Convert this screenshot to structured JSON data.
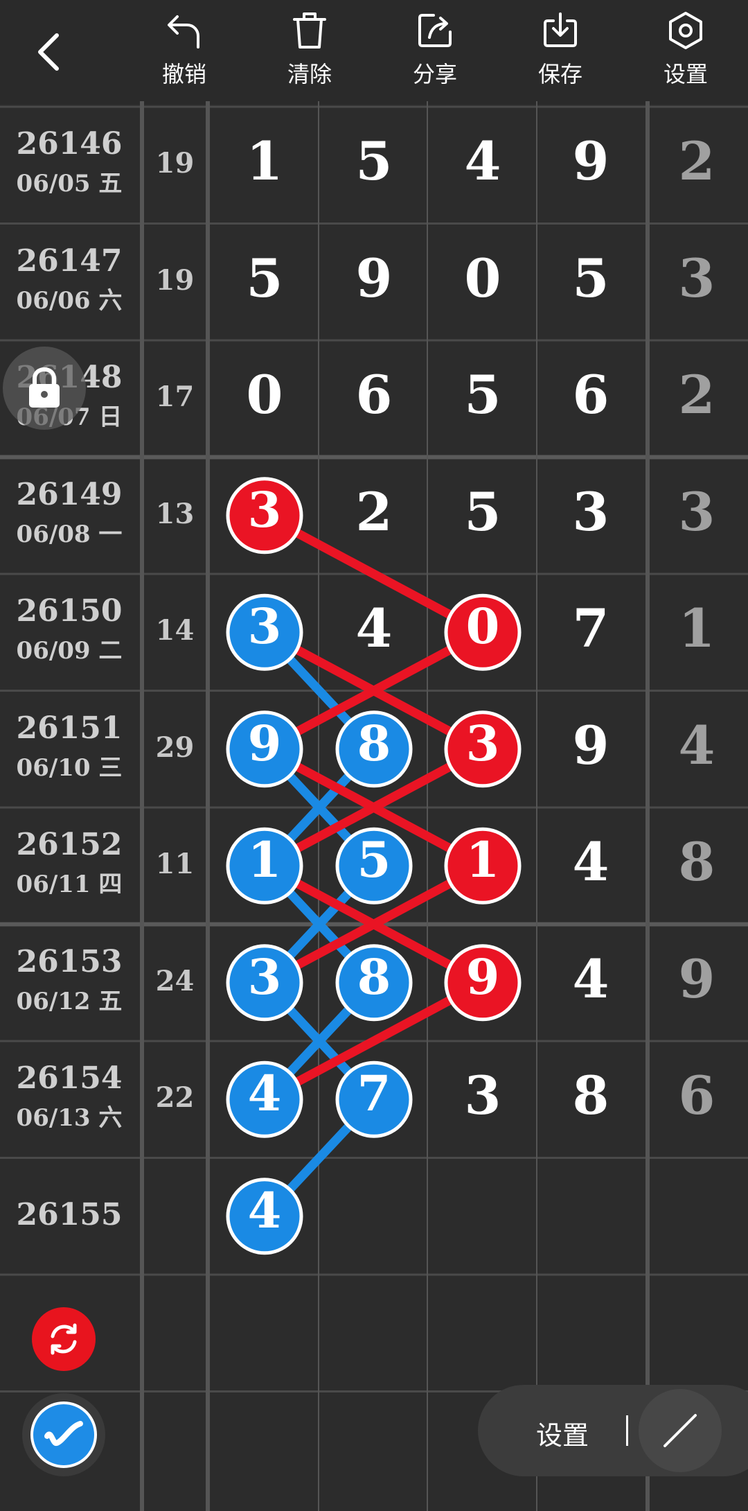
{
  "toolbar": {
    "back_icon": "chevron-left-icon",
    "items": [
      {
        "label": "撤销",
        "icon": "undo-icon"
      },
      {
        "label": "清除",
        "icon": "trash-icon"
      },
      {
        "label": "分享",
        "icon": "share-icon"
      },
      {
        "label": "保存",
        "icon": "download-icon"
      },
      {
        "label": "设置",
        "icon": "hexagon-settings-icon"
      }
    ]
  },
  "rows": [
    {
      "period": "26146",
      "date": "06/05 五",
      "sum": "19",
      "digits": [
        "1",
        "5",
        "4",
        "9"
      ],
      "fifth": "2"
    },
    {
      "period": "26147",
      "date": "06/06 六",
      "sum": "19",
      "digits": [
        "5",
        "9",
        "0",
        "5"
      ],
      "fifth": "3"
    },
    {
      "period": "26148",
      "date": "06/07 日",
      "sum": "17",
      "digits": [
        "0",
        "6",
        "5",
        "6"
      ],
      "fifth": "2"
    },
    {
      "period": "26149",
      "date": "06/08 一",
      "sum": "13",
      "digits": [
        "3",
        "2",
        "5",
        "3"
      ],
      "fifth": "3"
    },
    {
      "period": "26150",
      "date": "06/09 二",
      "sum": "14",
      "digits": [
        "3",
        "4",
        "0",
        "7"
      ],
      "fifth": "1"
    },
    {
      "period": "26151",
      "date": "06/10 三",
      "sum": "29",
      "digits": [
        "9",
        "8",
        "3",
        "9"
      ],
      "fifth": "4"
    },
    {
      "period": "26152",
      "date": "06/11 四",
      "sum": "11",
      "digits": [
        "1",
        "5",
        "1",
        "4"
      ],
      "fifth": "8"
    },
    {
      "period": "26153",
      "date": "06/12 五",
      "sum": "24",
      "digits": [
        "3",
        "8",
        "9",
        "4"
      ],
      "fifth": "9"
    },
    {
      "period": "26154",
      "date": "06/13 六",
      "sum": "22",
      "digits": [
        "4",
        "7",
        "3",
        "8"
      ],
      "fifth": "6"
    },
    {
      "period": "26155",
      "date": "",
      "sum": "",
      "digits": [
        "4",
        "",
        "",
        ""
      ],
      "fifth": ""
    }
  ],
  "markers": {
    "red": [
      [
        3,
        0
      ],
      [
        4,
        2
      ],
      [
        5,
        2
      ],
      [
        6,
        2
      ],
      [
        7,
        2
      ]
    ],
    "blue": [
      [
        4,
        0
      ],
      [
        5,
        0
      ],
      [
        5,
        1
      ],
      [
        6,
        0
      ],
      [
        6,
        1
      ],
      [
        7,
        0
      ],
      [
        7,
        1
      ],
      [
        8,
        0
      ],
      [
        8,
        1
      ],
      [
        9,
        0
      ]
    ]
  },
  "connectors": {
    "red": [
      [
        [
          3,
          0
        ],
        [
          4,
          2
        ]
      ],
      [
        [
          4,
          0
        ],
        [
          5,
          2
        ]
      ],
      [
        [
          4,
          2
        ],
        [
          5,
          0
        ]
      ],
      [
        [
          5,
          0
        ],
        [
          6,
          2
        ]
      ],
      [
        [
          5,
          2
        ],
        [
          6,
          0
        ]
      ],
      [
        [
          6,
          0
        ],
        [
          7,
          2
        ]
      ],
      [
        [
          6,
          2
        ],
        [
          7,
          0
        ]
      ],
      [
        [
          7,
          2
        ],
        [
          8,
          0
        ]
      ]
    ],
    "blue": [
      [
        [
          4,
          0
        ],
        [
          5,
          1
        ]
      ],
      [
        [
          5,
          0
        ],
        [
          6,
          1
        ]
      ],
      [
        [
          5,
          1
        ],
        [
          6,
          0
        ]
      ],
      [
        [
          6,
          0
        ],
        [
          7,
          1
        ]
      ],
      [
        [
          6,
          1
        ],
        [
          7,
          0
        ]
      ],
      [
        [
          7,
          0
        ],
        [
          8,
          1
        ]
      ],
      [
        [
          7,
          1
        ],
        [
          8,
          0
        ]
      ],
      [
        [
          8,
          1
        ],
        [
          9,
          0
        ]
      ]
    ]
  },
  "colors": {
    "red": "#ea1424",
    "blue": "#1a8ae4",
    "background": "#2c2c2c",
    "grid": "#4a4a4a"
  },
  "floating": {
    "lock_icon": "lock-icon",
    "refresh_icon": "refresh-icon",
    "brush_icon": "brush-icon",
    "pen_icon": "pen-icon",
    "settings_label": "设置"
  }
}
